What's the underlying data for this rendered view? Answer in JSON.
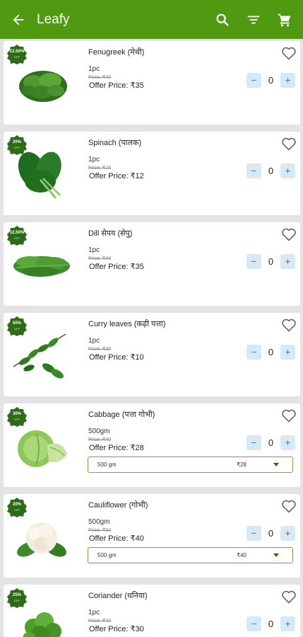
{
  "app": {
    "title": "Leafy",
    "colors": {
      "primary": "#4f9a10",
      "badge": "#2e6b19",
      "stepper": "#d6e9f7"
    },
    "icons": {
      "back": "arrow-left-icon",
      "search": "search-icon",
      "filter": "filter-icon",
      "cart": "cart-icon"
    }
  },
  "products": [
    {
      "name": "Fenugreek (मेथी)",
      "badge": "12.50%",
      "badge_sub": "OFF",
      "qty": "1pc",
      "price": "Price: ₹40",
      "offer": "Offer Price: ₹35",
      "count": "0",
      "image": "fenugreek"
    },
    {
      "name": "Spinach (पालक)",
      "badge": "20%",
      "badge_sub": "OFF",
      "qty": "1pc",
      "price": "Price: ₹15",
      "offer": "Offer Price: ₹12",
      "count": "0",
      "image": "spinach"
    },
    {
      "name": "Dill सेपय (सेपु)",
      "badge": "12.50%",
      "badge_sub": "OFF",
      "qty": "1pc",
      "price": "Price: ₹40",
      "offer": "Offer Price: ₹35",
      "count": "0",
      "image": "dill"
    },
    {
      "name": "Curry leaves (कढ़ी पत्ता)",
      "badge": "50%",
      "badge_sub": "OFF",
      "qty": "1pc",
      "price": "Price: ₹20",
      "offer": "Offer Price: ₹10",
      "count": "0",
      "image": "curry-leaves"
    },
    {
      "name": "Cabbage (पत्ता गोभी)",
      "badge": "30%",
      "badge_sub": "OFF",
      "qty": "500gm",
      "price": "Price: ₹40",
      "offer": "Offer Price: ₹28",
      "count": "0",
      "image": "cabbage",
      "variant": {
        "size": "500 gm",
        "price": "₹28"
      }
    },
    {
      "name": "Cauliflower (गोभी)",
      "badge": "20%",
      "badge_sub": "OFF",
      "qty": "500gm",
      "price": "Price: ₹50",
      "offer": "Offer Price: ₹40",
      "count": "0",
      "image": "cauliflower",
      "variant": {
        "size": "500 gm",
        "price": "₹40"
      }
    },
    {
      "name": "Coriander (धनिया)",
      "badge": "25%",
      "badge_sub": "OFF",
      "qty": "1pc",
      "price": "Price: ₹40",
      "offer": "Offer Price: ₹30",
      "count": "0",
      "image": "coriander"
    }
  ]
}
